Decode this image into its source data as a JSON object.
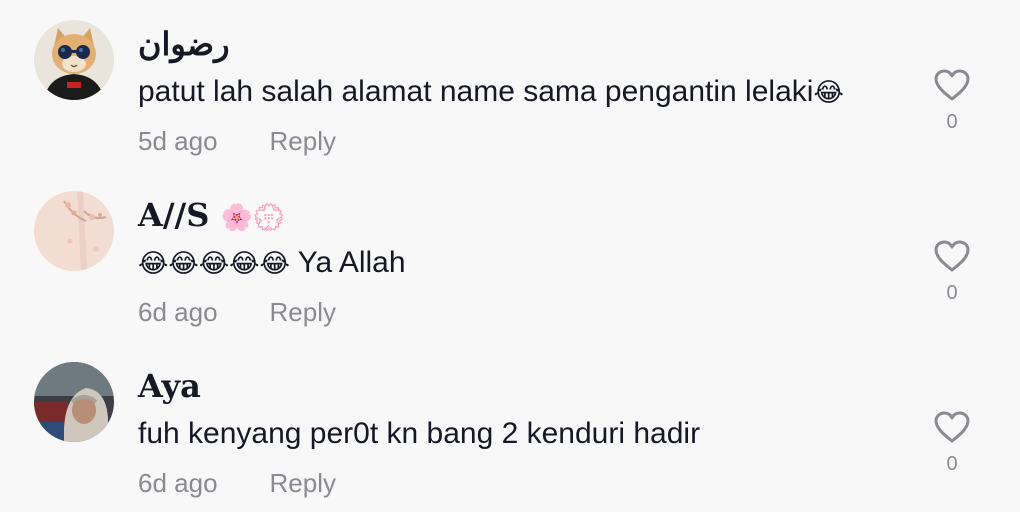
{
  "comments": [
    {
      "username": "رضوان",
      "text": "patut lah salah alamat name sama pengantin lelaki",
      "text_emoji": "😂",
      "time": "5d ago",
      "reply_label": "Reply",
      "like_count": "0",
      "avatar_icon": "cat-with-sunglasses-avatar"
    },
    {
      "username": "A//S",
      "username_emoji": "🌸💮",
      "text_emoji_prefix": "😂😂😂😂😂",
      "text": " Ya Allah",
      "time": "6d ago",
      "reply_label": "Reply",
      "like_count": "0",
      "avatar_icon": "blossom-photo-avatar"
    },
    {
      "username": "Aya",
      "text": "fuh kenyang per0t kn bang 2 kenduri hadir",
      "time": "6d ago",
      "reply_label": "Reply",
      "like_count": "0",
      "avatar_icon": "person-photo-avatar"
    }
  ],
  "colors": {
    "background": "#f8f8f8",
    "text_primary": "#161823",
    "text_secondary": "#8a8b91"
  }
}
